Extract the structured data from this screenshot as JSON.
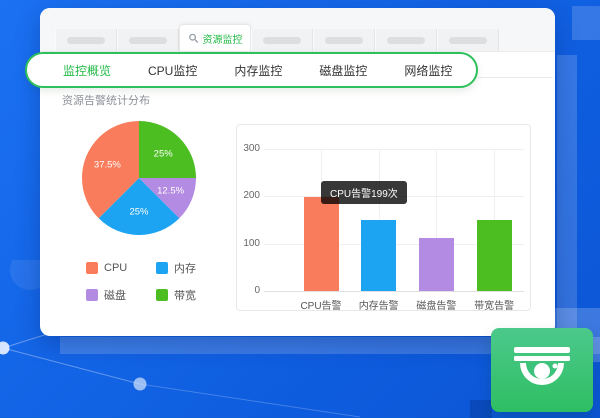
{
  "tabs": {
    "active_label": "资源监控",
    "placeholders_before": 2,
    "placeholders_after": 4
  },
  "nav": {
    "items": [
      {
        "label": "监控概览",
        "active": true
      },
      {
        "label": "CPU监控",
        "active": false
      },
      {
        "label": "内存监控",
        "active": false
      },
      {
        "label": "磁盘监控",
        "active": false
      },
      {
        "label": "网络监控",
        "active": false
      }
    ]
  },
  "content": {
    "section_title": "资源告警统计分布"
  },
  "colors": {
    "nav_green": "#2EC05A",
    "active_text_green": "#21BA45",
    "cpu": "#F97C5C",
    "memory": "#1CA3F2",
    "disk": "#B38BE2",
    "bandwidth": "#4CBE22",
    "tooltip_bg": "rgba(0,0,0,0.78)",
    "background_blue": "#1268EE",
    "widget_green": "#3DC27C"
  },
  "chart_data": [
    {
      "type": "pie",
      "title": "",
      "start_angle_deg_from_top": 0,
      "direction": "clockwise",
      "slices": [
        {
          "label": "带宽",
          "value": 25,
          "display": "25%",
          "color": "#4CBE22"
        },
        {
          "label": "磁盘",
          "value": 12.5,
          "display": "12.5%",
          "color": "#B38BE2"
        },
        {
          "label": "内存",
          "value": 25,
          "display": "25%",
          "color": "#1CA3F2"
        },
        {
          "label": "CPU",
          "value": 37.5,
          "display": "37.5%",
          "color": "#F97C5C"
        }
      ],
      "legend": [
        {
          "label": "CPU",
          "color": "#F97C5C"
        },
        {
          "label": "内存",
          "color": "#1CA3F2"
        },
        {
          "label": "磁盘",
          "color": "#B38BE2"
        },
        {
          "label": "带宽",
          "color": "#4CBE22"
        }
      ],
      "legend_position": "bottom-left"
    },
    {
      "type": "bar",
      "categories": [
        "CPU告警",
        "内存告警",
        "磁盘告警",
        "带宽告警"
      ],
      "values": [
        199,
        150,
        112,
        150
      ],
      "bar_colors": [
        "#F97C5C",
        "#1CA3F2",
        "#B38BE2",
        "#4CBE22"
      ],
      "ylim": [
        0,
        300
      ],
      "yticks": [
        0,
        100,
        200,
        300
      ],
      "grid": true,
      "tooltip": {
        "text": "CPU告警199次",
        "target_index": 0
      }
    }
  ],
  "widget": {
    "icon": "dome-camera-icon"
  }
}
